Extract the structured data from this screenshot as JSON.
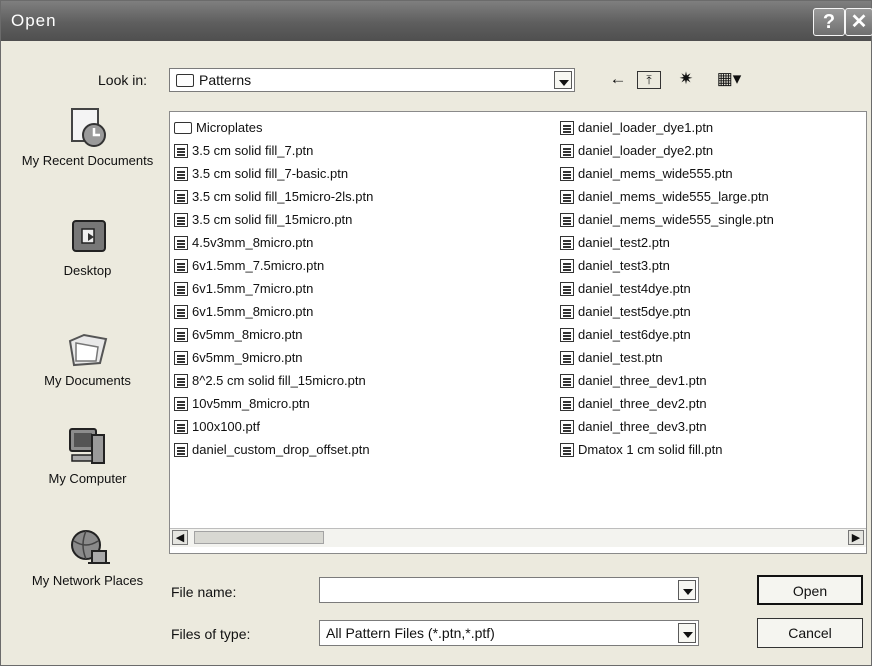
{
  "window": {
    "title": "Open"
  },
  "toolbar": {
    "look_in_label": "Look in:",
    "look_in_value": "Patterns",
    "back_glyph": "←",
    "up_glyph": "⤒",
    "new_folder_glyph": "✷",
    "views_glyph": "▦▾"
  },
  "places": [
    {
      "label": "My Recent Documents",
      "icon": "recent-documents-icon"
    },
    {
      "label": "Desktop",
      "icon": "desktop-icon"
    },
    {
      "label": "My Documents",
      "icon": "my-documents-icon"
    },
    {
      "label": "My Computer",
      "icon": "my-computer-icon"
    },
    {
      "label": "My Network Places",
      "icon": "network-places-icon"
    }
  ],
  "files_col1": [
    {
      "name": "Microplates",
      "type": "folder"
    },
    {
      "name": "3.5 cm solid fill_7.ptn",
      "type": "file"
    },
    {
      "name": "3.5 cm solid fill_7-basic.ptn",
      "type": "file"
    },
    {
      "name": "3.5 cm solid fill_15micro-2ls.ptn",
      "type": "file"
    },
    {
      "name": "3.5 cm solid fill_15micro.ptn",
      "type": "file"
    },
    {
      "name": "4.5v3mm_8micro.ptn",
      "type": "file"
    },
    {
      "name": "6v1.5mm_7.5micro.ptn",
      "type": "file"
    },
    {
      "name": "6v1.5mm_7micro.ptn",
      "type": "file"
    },
    {
      "name": "6v1.5mm_8micro.ptn",
      "type": "file"
    },
    {
      "name": "6v5mm_8micro.ptn",
      "type": "file"
    },
    {
      "name": "6v5mm_9micro.ptn",
      "type": "file"
    },
    {
      "name": "8^2.5 cm solid fill_15micro.ptn",
      "type": "file"
    },
    {
      "name": "10v5mm_8micro.ptn",
      "type": "file"
    },
    {
      "name": "100x100.ptf",
      "type": "file"
    },
    {
      "name": "daniel_custom_drop_offset.ptn",
      "type": "file"
    }
  ],
  "files_col2": [
    {
      "name": "daniel_loader_dye1.ptn",
      "type": "file"
    },
    {
      "name": "daniel_loader_dye2.ptn",
      "type": "file"
    },
    {
      "name": "daniel_mems_wide555.ptn",
      "type": "file"
    },
    {
      "name": "daniel_mems_wide555_large.ptn",
      "type": "file"
    },
    {
      "name": "daniel_mems_wide555_single.ptn",
      "type": "file"
    },
    {
      "name": "daniel_test2.ptn",
      "type": "file"
    },
    {
      "name": "daniel_test3.ptn",
      "type": "file"
    },
    {
      "name": "daniel_test4dye.ptn",
      "type": "file"
    },
    {
      "name": "daniel_test5dye.ptn",
      "type": "file"
    },
    {
      "name": "daniel_test6dye.ptn",
      "type": "file"
    },
    {
      "name": "daniel_test.ptn",
      "type": "file"
    },
    {
      "name": "daniel_three_dev1.ptn",
      "type": "file"
    },
    {
      "name": "daniel_three_dev2.ptn",
      "type": "file"
    },
    {
      "name": "daniel_three_dev3.ptn",
      "type": "file"
    },
    {
      "name": "Dmatox 1 cm solid fill.ptn",
      "type": "file"
    }
  ],
  "scroll": {
    "left_glyph": "◀",
    "right_glyph": "▶"
  },
  "form": {
    "file_name_label": "File name:",
    "file_name_value": "",
    "file_type_label": "Files of type:",
    "file_type_value": "All Pattern Files (*.ptn,*.ptf)"
  },
  "buttons": {
    "open": "Open",
    "cancel": "Cancel",
    "help_glyph": "?",
    "close_glyph": "✕"
  },
  "colors": {
    "titlebar": "#5e5e5e",
    "dialog_bg": "#eceade",
    "list_bg": "#ffffff"
  }
}
